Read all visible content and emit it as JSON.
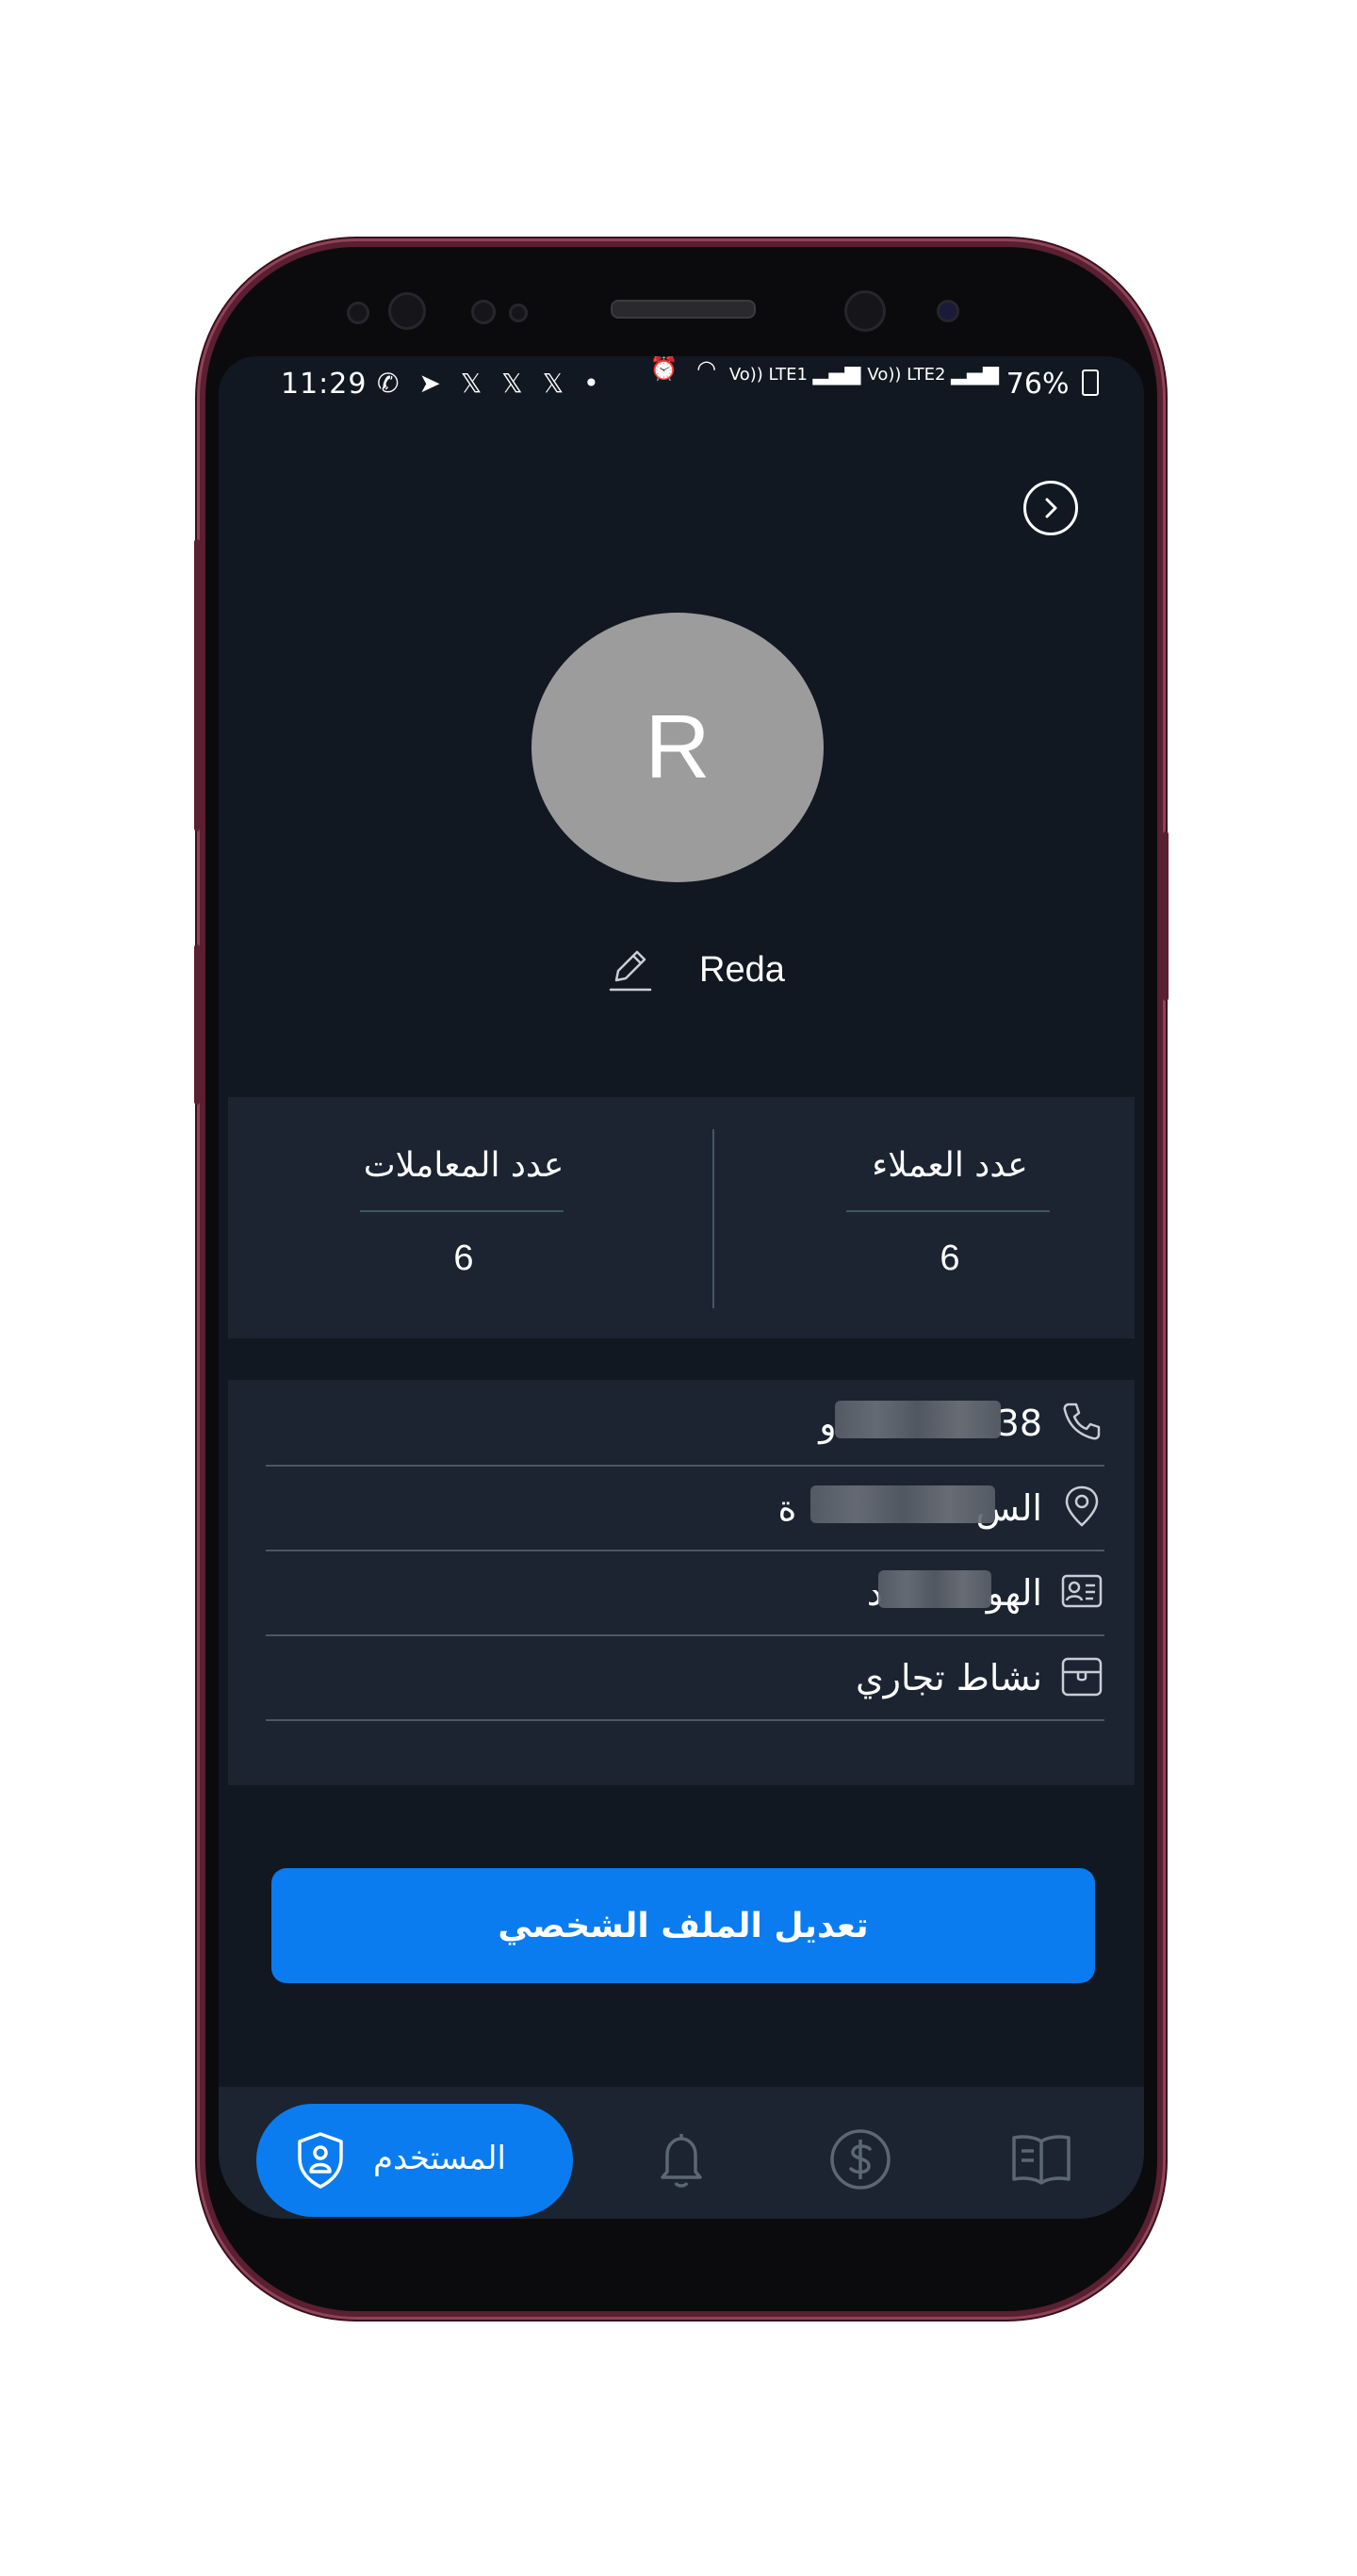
{
  "status_bar": {
    "time": "11:29",
    "left_icons": "✆ ➤ 𝕏 𝕏 𝕏 •",
    "right_indicators": "Vo)) LTE1",
    "right_indicators_2": "Vo)) LTE2",
    "battery": "76%"
  },
  "profile": {
    "avatar_initial": "R",
    "name": "Reda"
  },
  "stats": {
    "transactions_label": "عدد المعاملات",
    "transactions_value": "6",
    "customers_label": "عدد العملاء",
    "customers_value": "6"
  },
  "info": {
    "phone_visible": "38",
    "phone_prefix": "و",
    "address_visible": "الس",
    "address_end": "ة",
    "id_visible": "الهو",
    "id_end": "د",
    "business_activity": "نشاط تجاري"
  },
  "actions": {
    "edit_profile": "تعديل الملف الشخصي"
  },
  "bottom_nav": {
    "active_label": "المستخدم",
    "items": [
      "user-shield-icon",
      "bell-icon",
      "dollar-icon",
      "book-icon"
    ]
  },
  "colors": {
    "background": "#121821",
    "card": "#1b2430",
    "accent": "#0a7cf0",
    "avatar": "#9c9c9c"
  }
}
